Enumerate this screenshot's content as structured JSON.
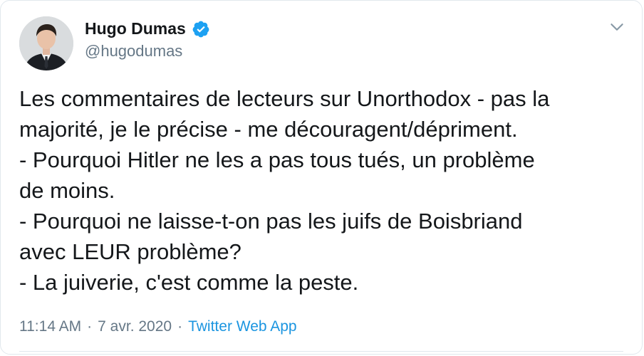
{
  "tweet": {
    "author": {
      "display_name": "Hugo Dumas",
      "handle": "@hugodumas",
      "verified": true,
      "verified_color": "#1da1f2"
    },
    "text": "Les commentaires de lecteurs sur Unorthodox - pas la\nmajorité, je le précise - me découragent/dépriment.\n- Pourquoi Hitler ne les a pas tous tués, un problème\nde moins.\n- Pourquoi ne laisse-t-on pas les juifs de Boisbriand\navec LEUR problème?\n- La juiverie, c'est comme la peste.",
    "time": "11:14 AM",
    "date": "7 avr. 2020",
    "separator": "·",
    "source": "Twitter Web App",
    "link_color": "#1b95e0",
    "menu_icon": "chevron-down-icon"
  }
}
